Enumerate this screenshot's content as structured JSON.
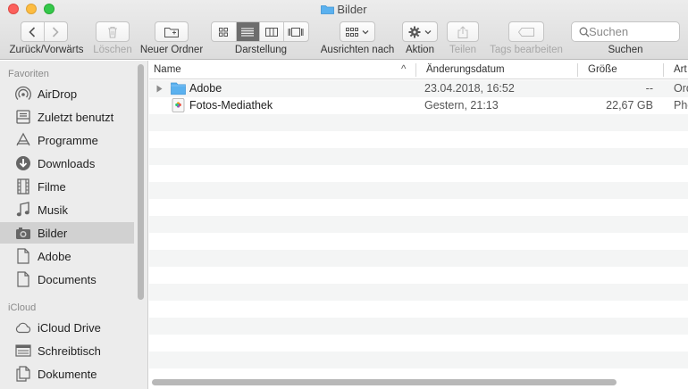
{
  "window": {
    "title": "Bilder"
  },
  "toolbar": {
    "nav_label": "Zurück/Vorwärts",
    "delete_label": "Löschen",
    "new_folder_label": "Neuer Ordner",
    "view_label": "Darstellung",
    "arrange_label": "Ausrichten nach",
    "action_label": "Aktion",
    "share_label": "Teilen",
    "tags_label": "Tags bearbeiten",
    "search_placeholder": "Suchen",
    "search_label": "Suchen"
  },
  "sidebar": {
    "favorites_heading": "Favoriten",
    "favorites": [
      {
        "label": "AirDrop",
        "icon": "airdrop-icon"
      },
      {
        "label": "Zuletzt benutzt",
        "icon": "recents-icon"
      },
      {
        "label": "Programme",
        "icon": "applications-icon"
      },
      {
        "label": "Downloads",
        "icon": "downloads-icon"
      },
      {
        "label": "Filme",
        "icon": "movies-icon"
      },
      {
        "label": "Musik",
        "icon": "music-icon"
      },
      {
        "label": "Bilder",
        "icon": "pictures-icon",
        "selected": true
      },
      {
        "label": "Adobe",
        "icon": "document-icon"
      },
      {
        "label": "Documents",
        "icon": "document-icon"
      }
    ],
    "icloud_heading": "iCloud",
    "icloud": [
      {
        "label": "iCloud Drive",
        "icon": "cloud-icon"
      },
      {
        "label": "Schreibtisch",
        "icon": "desktop-icon"
      },
      {
        "label": "Dokumente",
        "icon": "documents-icon"
      }
    ]
  },
  "columns": {
    "name": "Name",
    "sort_indicator": "^",
    "date": "Änderungsdatum",
    "size": "Größe",
    "kind": "Art"
  },
  "files": [
    {
      "name": "Adobe",
      "date": "23.04.2018, 16:52",
      "size": "--",
      "kind": "Ord",
      "icon": "folder-icon"
    },
    {
      "name": "Fotos-Mediathek",
      "date": "Gestern, 21:13",
      "size": "22,67 GB",
      "kind": "Pho",
      "icon": "photos-library-icon"
    }
  ],
  "colors": {
    "toolbar_bg": "#dcdcdc",
    "sidebar_bg": "#ececec",
    "sidebar_selected": "#d1d1d1",
    "folder_blue": "#5ab1ef",
    "close": "#fc605c",
    "minimize": "#fdbc40",
    "maximize": "#34c84a"
  }
}
